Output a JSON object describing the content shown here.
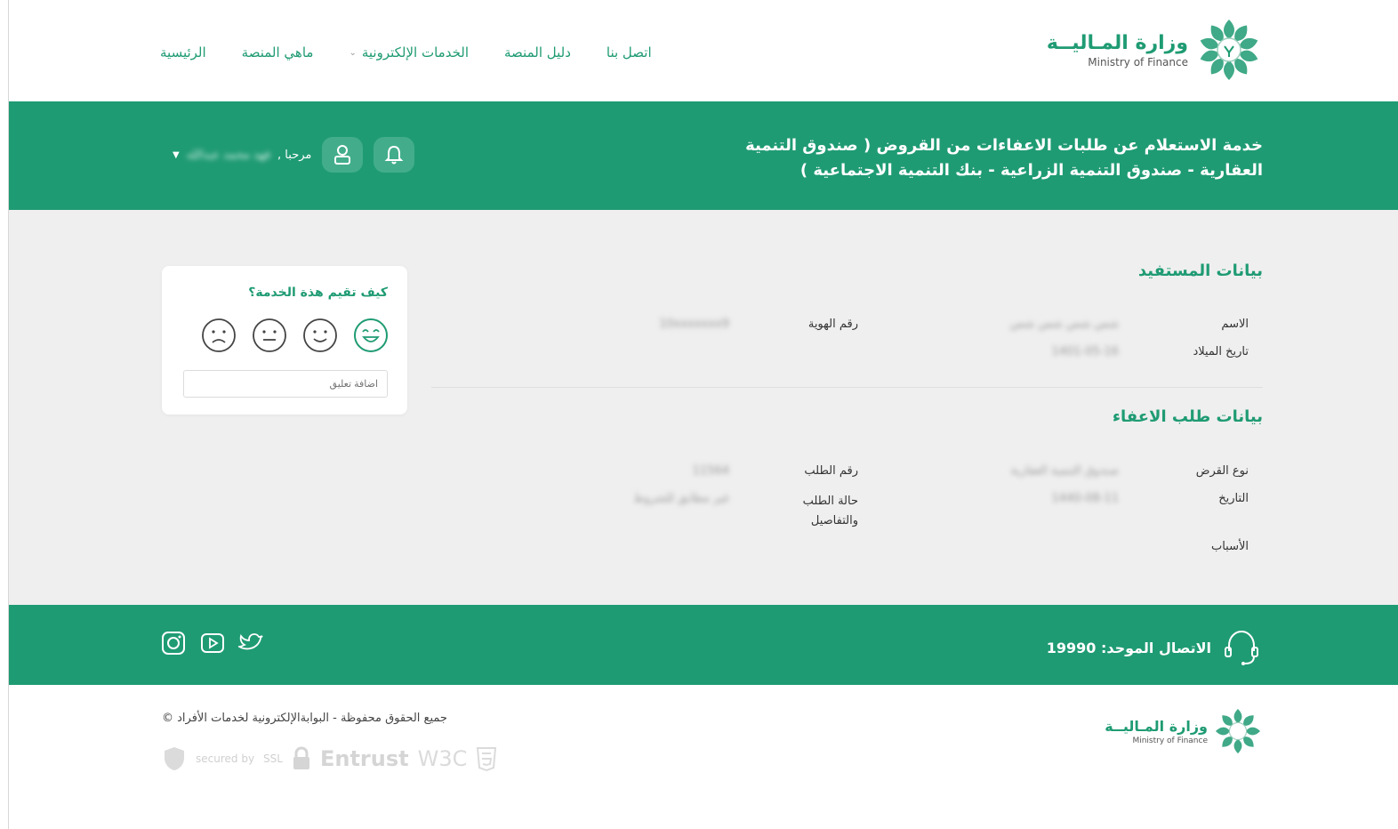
{
  "logo": {
    "arabic": "وزارة المـاليــة",
    "english": "Ministry of Finance"
  },
  "nav": {
    "items": [
      {
        "label": "الرئيسية"
      },
      {
        "label": "ماهي المنصة"
      },
      {
        "label": "الخدمات الإلكترونية",
        "has_dropdown": true
      },
      {
        "label": "دليل المنصة"
      },
      {
        "label": "اتصل بنا"
      }
    ]
  },
  "header": {
    "service_title": "خدمة الاستعلام عن طلبات الاعفاءات من القروض ( صندوق التنمية العقارية - صندوق التنمية الزراعية - بنك التنمية الاجتماعية )",
    "welcome": "مرحبا ,",
    "user_name": "فهد محمد عبدالله"
  },
  "beneficiary": {
    "title": "بيانات المستفيد",
    "name_label": "الاسم",
    "name_value": "شس شس شس شس",
    "birth_label": "تاريخ الميلاد",
    "birth_value": "1401-05-16",
    "id_label": "رقم الهوية",
    "id_value": "10xxxxxxx9"
  },
  "request": {
    "title": "بيانات طلب الاعفاء",
    "loan_type_label": "نوع القرض",
    "loan_type_value": "صندوق التنمية العقارية",
    "date_label": "التاريخ",
    "date_value": "1440-08-11",
    "request_no_label": "رقم الطلب",
    "request_no_value": "11564",
    "status_label": "حالة الطلب والتفاصيل",
    "status_value": "غير مطابق للشروط",
    "reasons_label": "الأسباب"
  },
  "rating": {
    "title": "كيف تقيم هذة الخدمة؟",
    "comment_placeholder": "اضافة تعليق"
  },
  "footer": {
    "hotline": "الاتصال الموحد: 19990",
    "copyright": "جميع الحقوق محفوظة - البوابةالإلكترونية لخدمات الأفراد ©",
    "badges": {
      "secured_by": "secured by",
      "ssl": "SSL",
      "entrust": "Entrust",
      "w3c": "W3C"
    }
  },
  "colors": {
    "brand_green": "#1f9b73",
    "band_button": "#43ad8b",
    "main_bg": "#efefef"
  }
}
